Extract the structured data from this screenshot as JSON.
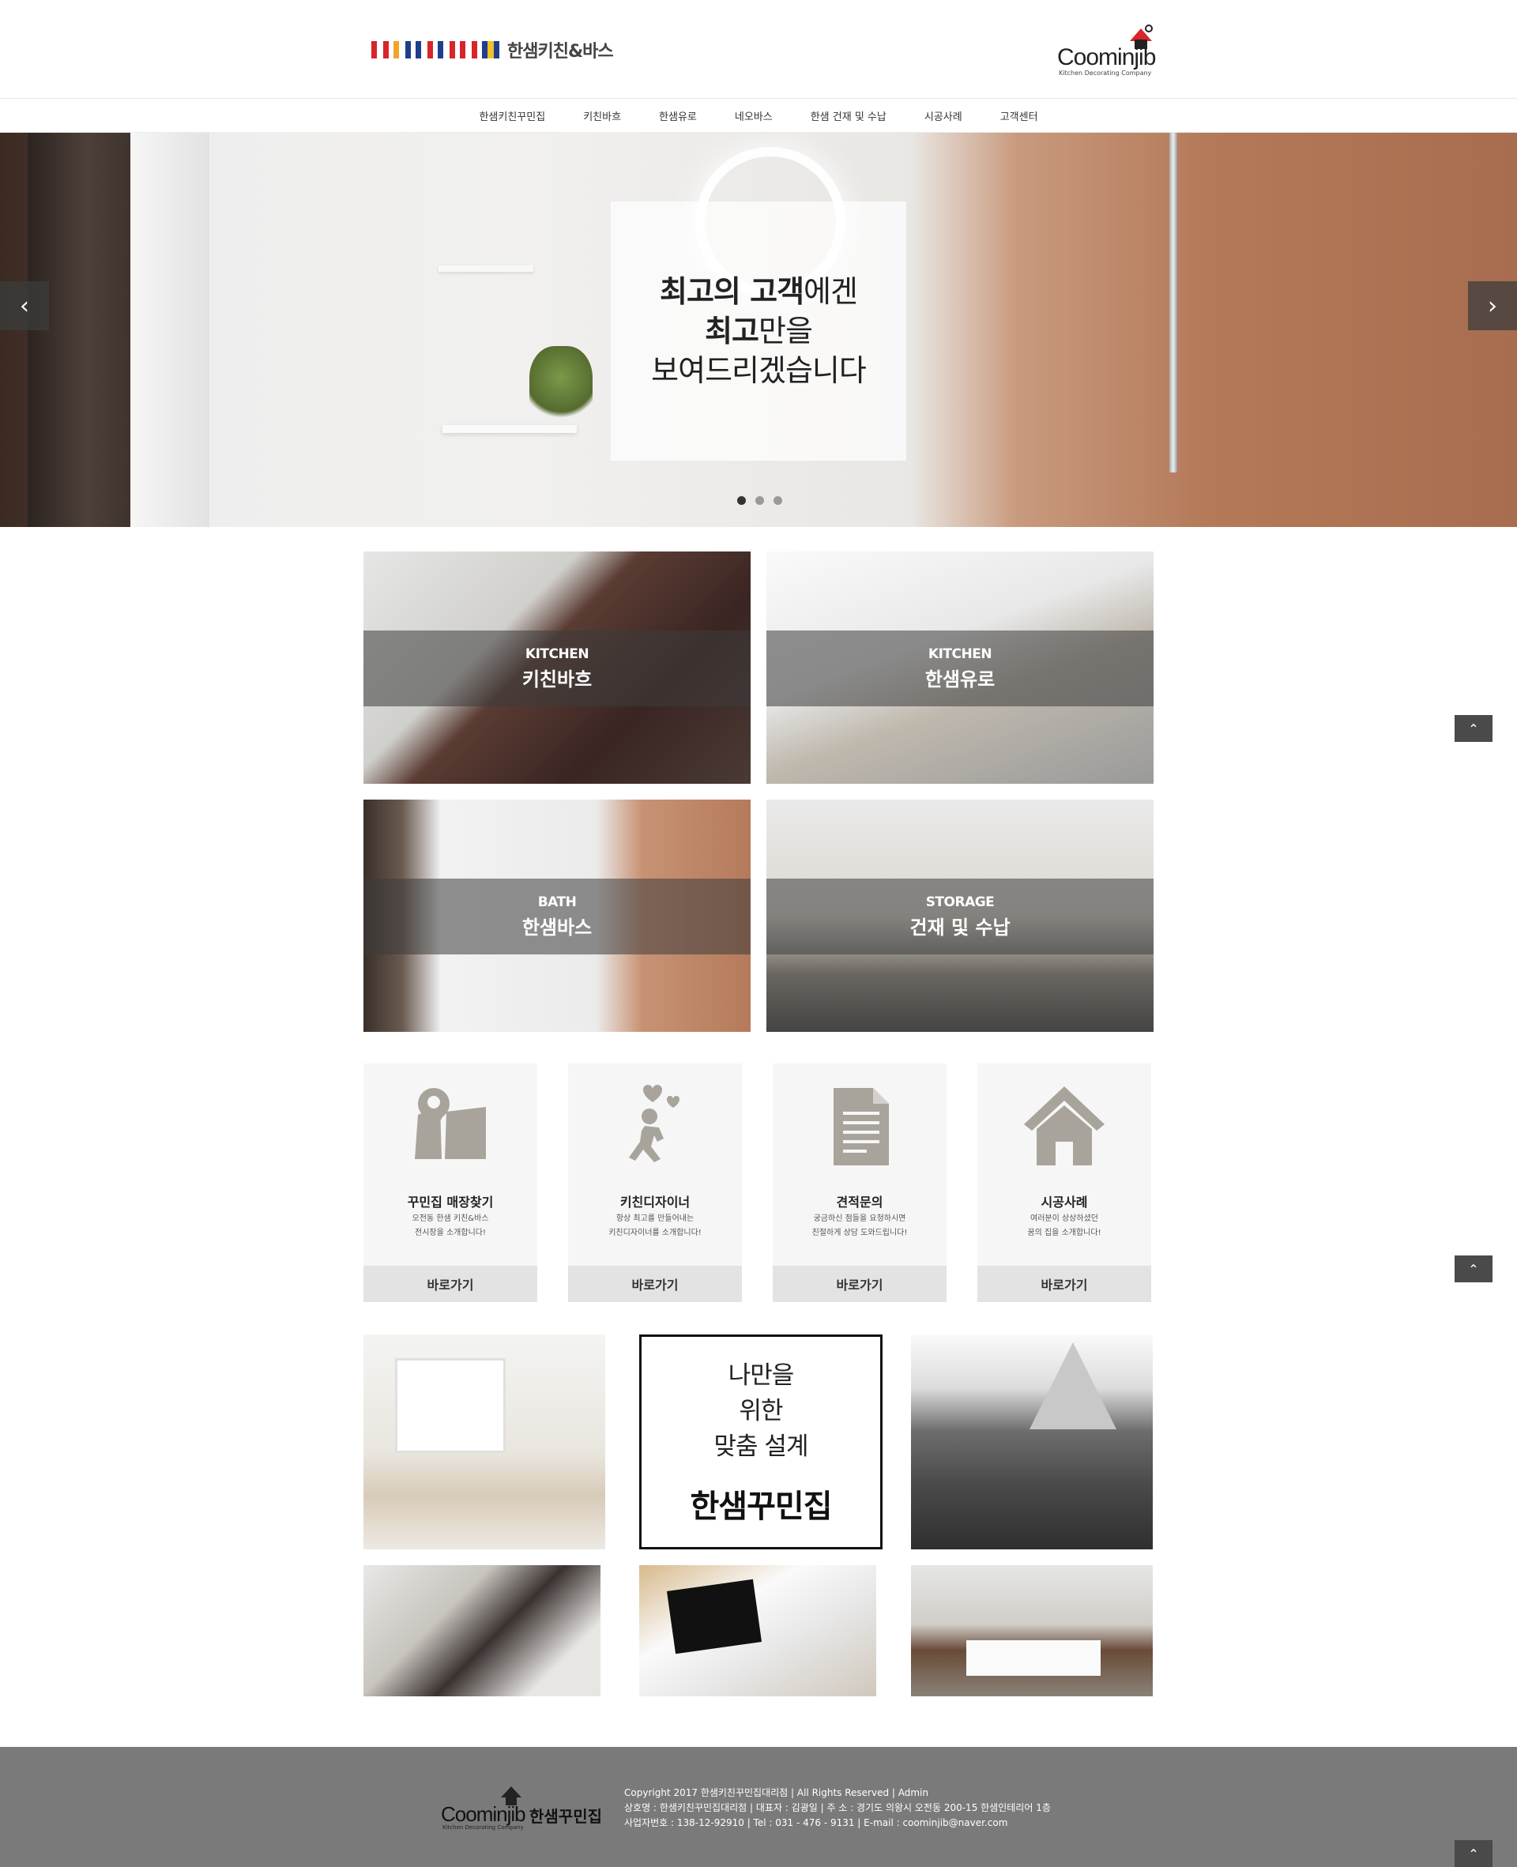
{
  "header": {
    "brand_name": "한샘키친&바스",
    "partner_logo": "Coominjib",
    "partner_tagline": "Kitchen Decorating Company"
  },
  "nav": {
    "items": [
      "한샘키친꾸민집",
      "키친바흐",
      "한샘유로",
      "네오바스",
      "한샘 건재 및 수납",
      "시공사례",
      "고객센터"
    ]
  },
  "hero": {
    "line1_bold": "최고의 고객",
    "line1_rest": "에겐",
    "line2_bold": "최고",
    "line2_rest": "만을",
    "line3": "보여드리겠습니다",
    "prev_icon": "chevron-left-icon",
    "next_icon": "chevron-right-icon",
    "slides": 3,
    "active_slide": 1
  },
  "tiles": [
    {
      "en": "KITCHEN",
      "ko": "키친바흐"
    },
    {
      "en": "KITCHEN",
      "ko": "한샘유로"
    },
    {
      "en": "BATH",
      "ko": "한샘바스"
    },
    {
      "en": "STORAGE",
      "ko": "건재 및 수납"
    }
  ],
  "cards": [
    {
      "icon": "map-pin-icon",
      "title": "꾸민집 매장찾기",
      "desc1": "오전동 한샘 키친&바스",
      "desc2": "전시장을 소개합니다!",
      "button": "바로가기"
    },
    {
      "icon": "runner-icon",
      "title": "키친디자이너",
      "desc1": "항상 최고를 만들어내는",
      "desc2": "키친디자이너를 소개합니다!",
      "button": "바로가기"
    },
    {
      "icon": "document-icon",
      "title": "견적문의",
      "desc1": "궁금하신 점들을 요청하시면",
      "desc2": "친절하게 상담 도와드립니다!",
      "button": "바로가기"
    },
    {
      "icon": "house-icon",
      "title": "시공사례",
      "desc1": "여러분이 상상하셨던",
      "desc2": "꿈의 집을 소개합니다!",
      "button": "바로가기"
    }
  ],
  "feature": {
    "line1": "나만을",
    "line2": "위한",
    "line3": "맞춤 설계",
    "brand": "한샘꾸민집"
  },
  "footer": {
    "logo": "Coominjib",
    "logo_ko": "한샘꾸민집",
    "logo_tagline": "Kitchen Decorating Company",
    "copyright": "Copyright 2017 한샘키친꾸민집대리점 | All Rights Reserved | Admin",
    "company": "상호명 : 한샘키친꾸민집대리점 | 대표자 : 김광일 | 주 소 : 경기도 의왕시 오전동 200-15 한샘인테리어 1층",
    "business": "사업자번호 : 138-12-92910 | Tel : 031 - 476 - 9131 | E-mail : coominjib@naver.com"
  },
  "scroll_top_icon": "chevron-up-icon",
  "colors": {
    "tile_band": "#3c3c3c",
    "card_bg": "#f6f6f6",
    "card_button": "#e3e3e3",
    "footer_bg": "#7a7a7a",
    "icon_gray": "#a8a49c"
  }
}
